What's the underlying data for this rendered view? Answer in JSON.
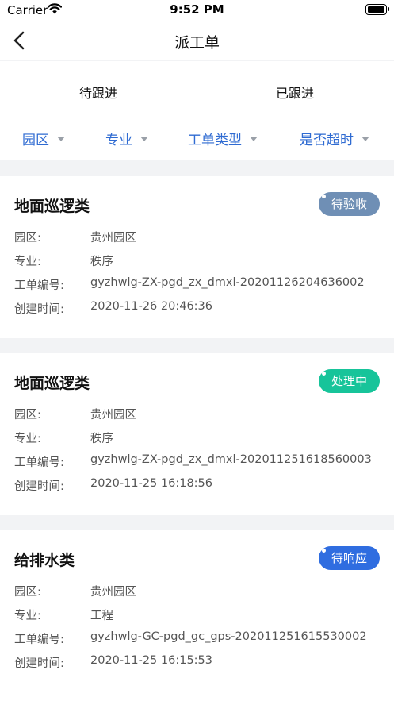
{
  "status_bar": {
    "carrier": "Carrier",
    "time": "9:52 PM"
  },
  "navbar": {
    "title": "派工单"
  },
  "tabs": [
    {
      "label": "待跟进"
    },
    {
      "label": "已跟进"
    }
  ],
  "filters": [
    {
      "label": "园区"
    },
    {
      "label": "专业"
    },
    {
      "label": "工单类型"
    },
    {
      "label": "是否超时"
    }
  ],
  "field_labels": {
    "park": "园区:",
    "specialty": "专业:",
    "order_no": "工单编号:",
    "created": "创建时间:"
  },
  "orders": [
    {
      "category": "地面巡逻类",
      "status": "待验收",
      "status_color": "#6f8fb5",
      "park": "贵州园区",
      "specialty": "秩序",
      "order_no": "gyzhwlg-ZX-pgd_zx_dmxl-20201126204636002",
      "created": "2020-11-26 20:46:36"
    },
    {
      "category": "地面巡逻类",
      "status": "处理中",
      "status_color": "#17c49a",
      "park": "贵州园区",
      "specialty": "秩序",
      "order_no": "gyzhwlg-ZX-pgd_zx_dmxl-202011251618560003",
      "created": "2020-11-25 16:18:56"
    },
    {
      "category": "给排水类",
      "status": "待响应",
      "status_color": "#2f6de0",
      "park": "贵州园区",
      "specialty": "工程",
      "order_no": "gyzhwlg-GC-pgd_gc_gps-202011251615530002",
      "created": "2020-11-25 16:15:53"
    }
  ]
}
